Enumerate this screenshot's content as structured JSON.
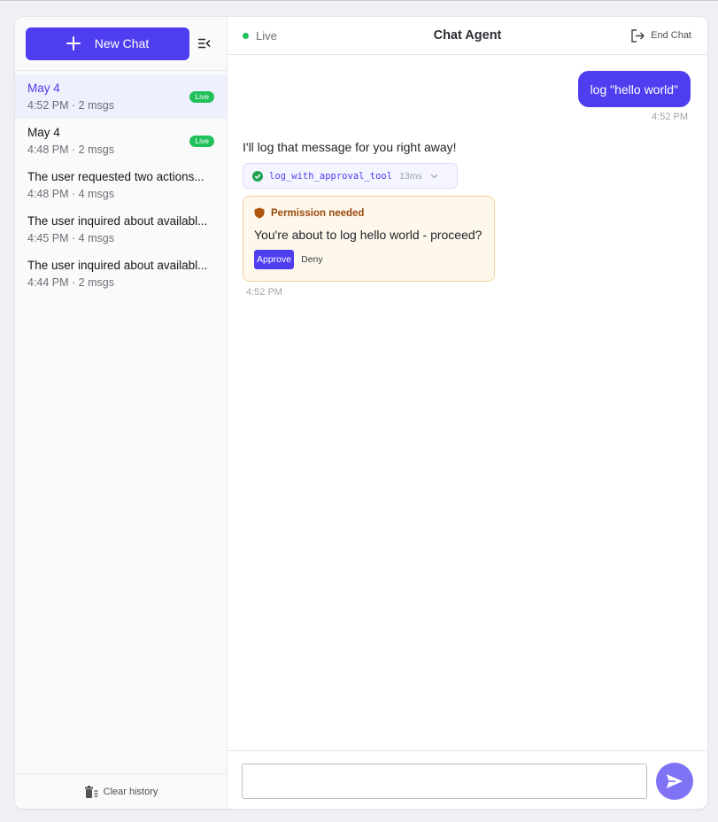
{
  "sidebar": {
    "new_chat_label": "New Chat",
    "sessions": [
      {
        "title": "May 4",
        "meta": "4:52 PM · 2 msgs",
        "badge": "Live",
        "active": true
      },
      {
        "title": "May 4",
        "meta": "4:48 PM · 2 msgs",
        "badge": "Live",
        "active": false
      },
      {
        "title": "The user requested two actions...",
        "meta": "4:48 PM · 4 msgs",
        "badge": "",
        "active": false
      },
      {
        "title": "The user inquired about availabl...",
        "meta": "4:45 PM · 4 msgs",
        "badge": "",
        "active": false
      },
      {
        "title": "The user inquired about availabl...",
        "meta": "4:44 PM · 2 msgs",
        "badge": "",
        "active": false
      }
    ],
    "clear_history_label": "Clear history"
  },
  "header": {
    "status_label": "Live",
    "title": "Chat Agent",
    "end_chat_label": "End Chat"
  },
  "messages": {
    "user_text": "log \"hello world\"",
    "user_time": "4:52 PM",
    "agent_text": "I'll log that message for you right away!",
    "tool": {
      "name": "log_with_approval_tool",
      "duration": "13ms"
    },
    "permission": {
      "heading": "Permission needed",
      "message": "You're about to log hello world - proceed?",
      "approve_label": "Approve",
      "deny_label": "Deny"
    },
    "agent_time": "4:52 PM"
  },
  "composer": {
    "placeholder": "",
    "value": ""
  },
  "colors": {
    "accent": "#4f3df0",
    "live_green": "#22c05b",
    "send_button": "#7f72f5",
    "permission_bg": "#fef7ec",
    "permission_border": "#f2d49a"
  },
  "icons": [
    "plus-icon",
    "collapse-sidebar-icon",
    "trash-icon",
    "exit-icon",
    "check-circle-icon",
    "chevron-down-icon",
    "shield-icon",
    "send-icon"
  ]
}
